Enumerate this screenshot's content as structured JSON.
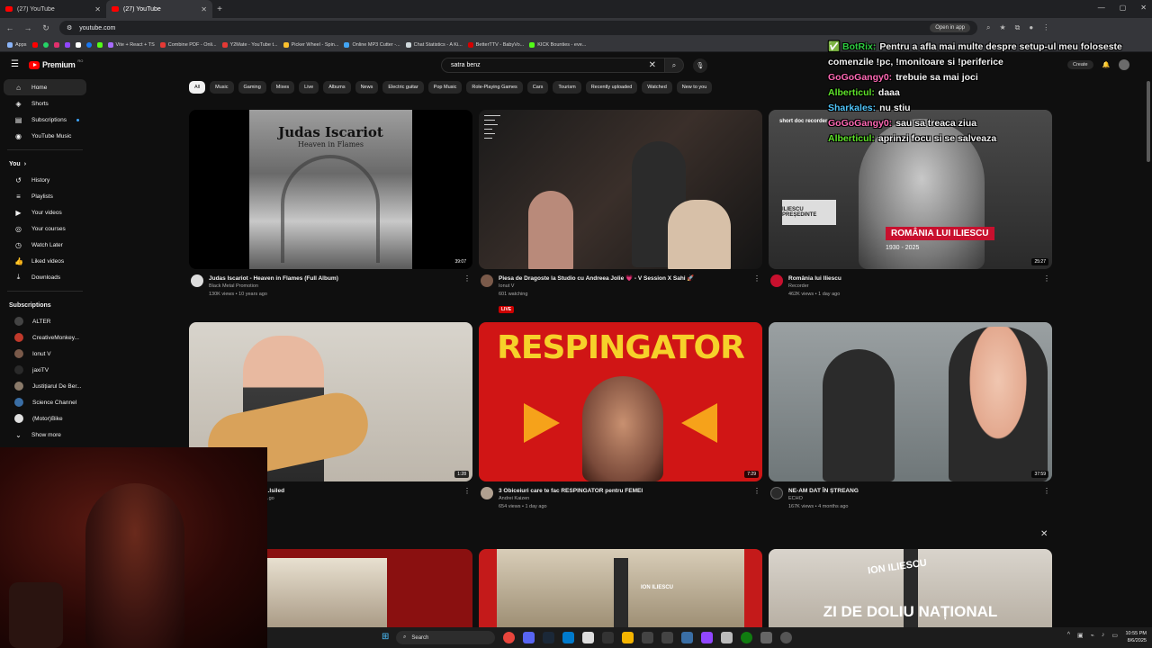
{
  "browser": {
    "tabs": [
      {
        "title": "(27) YouTube",
        "active": false
      },
      {
        "title": "(27) YouTube",
        "active": true
      }
    ],
    "url": "youtube.com",
    "open_in_app": "Open in app",
    "bookmarks": [
      "Apps",
      "Vite + React + TS",
      "Combine PDF - Onli...",
      "Y2Mate - YouTube t...",
      "Picker Wheel - Spin...",
      "Online MP3 Cutter -...",
      "Chat Statistics - A Ki...",
      "BetterTTV - BabyVo...",
      "KICK Bounties - eve..."
    ]
  },
  "youtube": {
    "logo_text": "Premium",
    "country": "RO",
    "search_query": "satra benz",
    "create_label": "Create",
    "notif_count": "9+",
    "chips": [
      "All",
      "Music",
      "Gaming",
      "Mixes",
      "Live",
      "Albums",
      "News",
      "Electric guitar",
      "Pop Music",
      "Role-Playing Games",
      "Cars",
      "Tourism",
      "Recently uploaded",
      "Watched",
      "New to you"
    ]
  },
  "sidebar": {
    "main": [
      {
        "label": "Home",
        "icon": "home-icon"
      },
      {
        "label": "Shorts",
        "icon": "shorts-icon"
      },
      {
        "label": "Subscriptions",
        "icon": "subscriptions-icon"
      },
      {
        "label": "YouTube Music",
        "icon": "music-icon"
      }
    ],
    "you_heading": "You",
    "you": [
      {
        "label": "History",
        "icon": "history-icon"
      },
      {
        "label": "Playlists",
        "icon": "playlists-icon"
      },
      {
        "label": "Your videos",
        "icon": "your-videos-icon"
      },
      {
        "label": "Your courses",
        "icon": "courses-icon"
      },
      {
        "label": "Watch Later",
        "icon": "watch-later-icon"
      },
      {
        "label": "Liked videos",
        "icon": "like-icon"
      },
      {
        "label": "Downloads",
        "icon": "download-icon"
      }
    ],
    "subs_heading": "Subscriptions",
    "subscriptions": [
      {
        "label": "ALTER",
        "color": "#444444"
      },
      {
        "label": "CreativeMonkey...",
        "color": "#c0392b"
      },
      {
        "label": "Ionut V",
        "color": "#7a5a4a"
      },
      {
        "label": "jaxiTV",
        "color": "#2a2a2a"
      },
      {
        "label": "Justițiarul De Ber...",
        "color": "#8a7a6a"
      },
      {
        "label": "Science Channel",
        "color": "#3a6ea5"
      },
      {
        "label": "(Motor)Bike",
        "color": "#e0e0e0"
      }
    ],
    "show_more": "Show more"
  },
  "videos": [
    {
      "title": "Judas Iscariot - Heaven in Flames (Full Album)",
      "channel": "Black Metal Promotion",
      "stats": "130K views • 10 years ago",
      "duration": "39:07",
      "thumb_title": "Judas Iscariot",
      "thumb_subtitle": "Heaven in Flames"
    },
    {
      "title": "Piesa de Dragoste la Studio cu Andreea Jolie 💗 - V Session X Sahi 🚀",
      "channel": "Ionut V",
      "stats": "601 watching",
      "live": "LIVE"
    },
    {
      "title": "România lui Iliescu",
      "channel": "Recorder",
      "stats": "462K views • 1 day ago",
      "duration": "25:27",
      "thumb_band": "ROMÂNIA LUI ILIESCU",
      "thumb_years": "1930 - 2025",
      "thumb_sign": "ILIESCU PREȘEDINTE",
      "thumb_badge": "short doc recorder"
    },
    {
      "title": "...lsiled",
      "channel": "",
      "stats": "...go",
      "duration": "1:28"
    },
    {
      "title": "3 Obiceiuri care te fac RESPINGATOR pentru FEMEI",
      "channel": "Andrei Kaizen",
      "stats": "654 views • 1 day ago",
      "duration": "7:29",
      "thumb_text": "RESPINGATOR"
    },
    {
      "title": "NE-AM DAT ÎN ȘTREANG",
      "channel": "ECHO",
      "stats": "167K views • 4 months ago",
      "duration": "37:59"
    },
    {
      "title": "",
      "channel": "",
      "stats": ""
    },
    {
      "title": "",
      "channel": "",
      "stats": "",
      "thumb_text": "ION ILIESCU"
    },
    {
      "title": "",
      "channel": "",
      "stats": "",
      "thumb_l1": "ION ILIESCU",
      "thumb_l2": "ZI DE DOLIU NAȚIONAL"
    }
  ],
  "chat": [
    {
      "user": "✅ BotRix:",
      "user_color": "#2ecc40",
      "msg": "Pentru a afla mai multe despre setup-ul meu foloseste comenzile !pc, !monitoare si !periferice"
    },
    {
      "user": "GoGoGangy0:",
      "user_color": "#ff69b4",
      "msg": "trebuie sa mai joci"
    },
    {
      "user": "Alberticul:",
      "user_color": "#5ee12a",
      "msg": "daaa"
    },
    {
      "user": "Sharkales:",
      "user_color": "#4fc3f7",
      "msg": "nu stiu"
    },
    {
      "user": "GoGoGangy0:",
      "user_color": "#ff69b4",
      "msg": "sau sa treaca ziua"
    },
    {
      "user": "Alberticul:",
      "user_color": "#5ee12a",
      "msg": "aprinzi focu si se salveaza"
    }
  ],
  "taskbar": {
    "search": "Search",
    "time": "10:55 PM",
    "date": "8/6/2025"
  }
}
